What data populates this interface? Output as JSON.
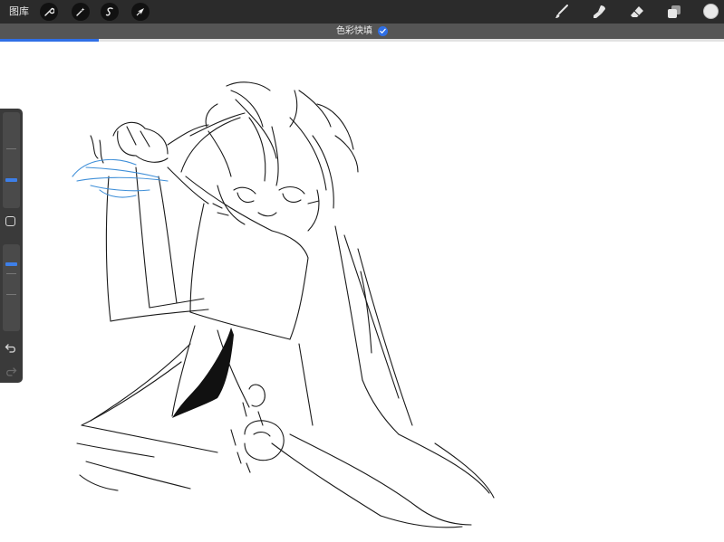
{
  "toolbar": {
    "gallery_label": "图库",
    "left_tools": [
      "wrench-icon",
      "magic-wand-icon",
      "selection-icon",
      "transform-arrow-icon"
    ],
    "right_tools": [
      "brush-icon",
      "smudge-icon",
      "eraser-icon",
      "layers-icon"
    ],
    "current_color": "#e9e9e9"
  },
  "status": {
    "label": "色彩快填",
    "progress_fraction": 0.137
  },
  "sidebar": {
    "brush_size_level": 0.72,
    "opacity_level": 0.22
  },
  "colors": {
    "accent": "#2f6fe6",
    "toolbar_bg": "#2b2b2b",
    "statusbar_bg": "#555555",
    "sketch_stroke": "#1a1a1a",
    "blue_stroke": "#3f8fd8"
  }
}
